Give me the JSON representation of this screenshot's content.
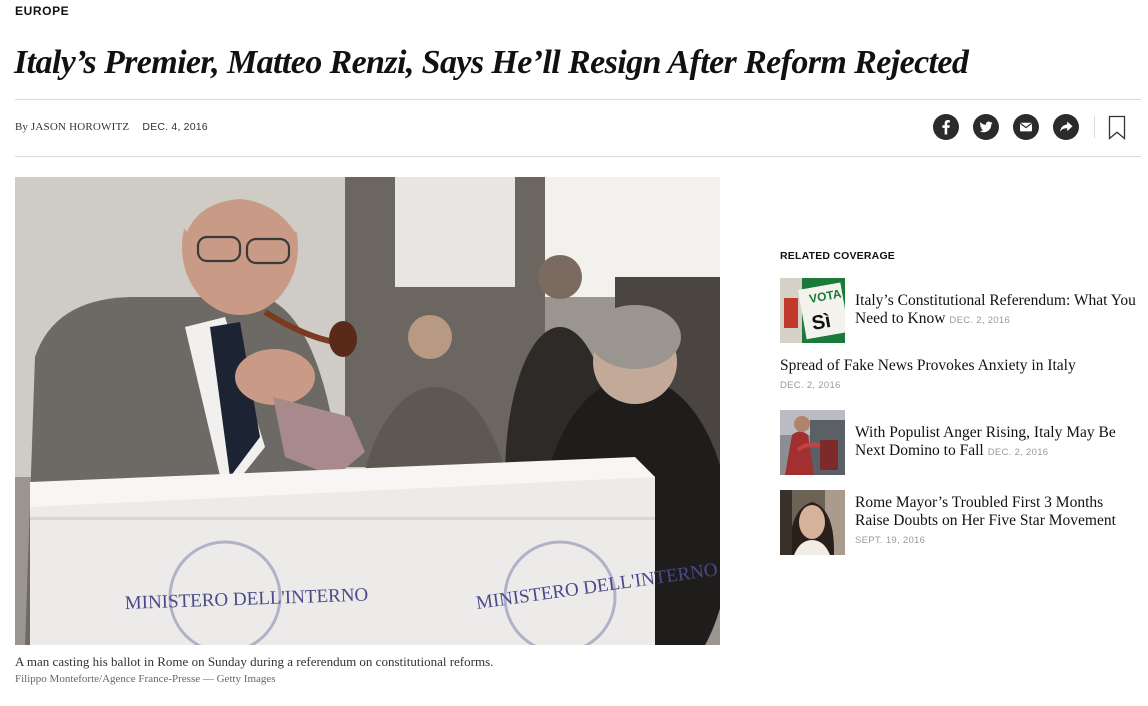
{
  "section": {
    "label": "EUROPE"
  },
  "article": {
    "headline": "Italy’s Premier, Matteo Renzi, Says He’ll Resign After Reform Rejected",
    "byline_prefix": "By",
    "author": "JASON HOROWITZ",
    "date": "DEC. 4, 2016"
  },
  "share": {
    "icons": [
      "facebook-icon",
      "twitter-icon",
      "email-icon",
      "share-icon",
      "bookmark-icon"
    ]
  },
  "photo": {
    "ballot_text_left": "MINISTERO DELL'INTERNO",
    "ballot_text_right": "MINISTERO DELL'INTERNO",
    "caption": "A man casting his ballot in Rome on Sunday during a referendum on constitutional reforms.",
    "credit": "Filippo Monteforte/Agence France-Presse — Getty Images"
  },
  "related": {
    "title": "RELATED COVERAGE",
    "items": [
      {
        "headline": "Italy’s Constitutional Referendum: What You Need to Know",
        "date": "DEC. 2, 2016",
        "thumb_text_1": "VOTA",
        "thumb_text_2": "Sì"
      },
      {
        "headline": "Spread of Fake News Provokes Anxiety in Italy",
        "date": "DEC. 2, 2016"
      },
      {
        "headline": "With Populist Anger Rising, Italy May Be Next Domino to Fall",
        "date": "DEC. 2, 2016"
      },
      {
        "headline": "Rome Mayor’s Troubled First 3 Months Raise Doubts on Her Five Star Movement",
        "date": "SEPT. 19, 2016"
      }
    ]
  },
  "colors": {
    "icon_bg": "#2b2b2b",
    "rule": "#dcdcdc",
    "date_gray": "#999999"
  }
}
